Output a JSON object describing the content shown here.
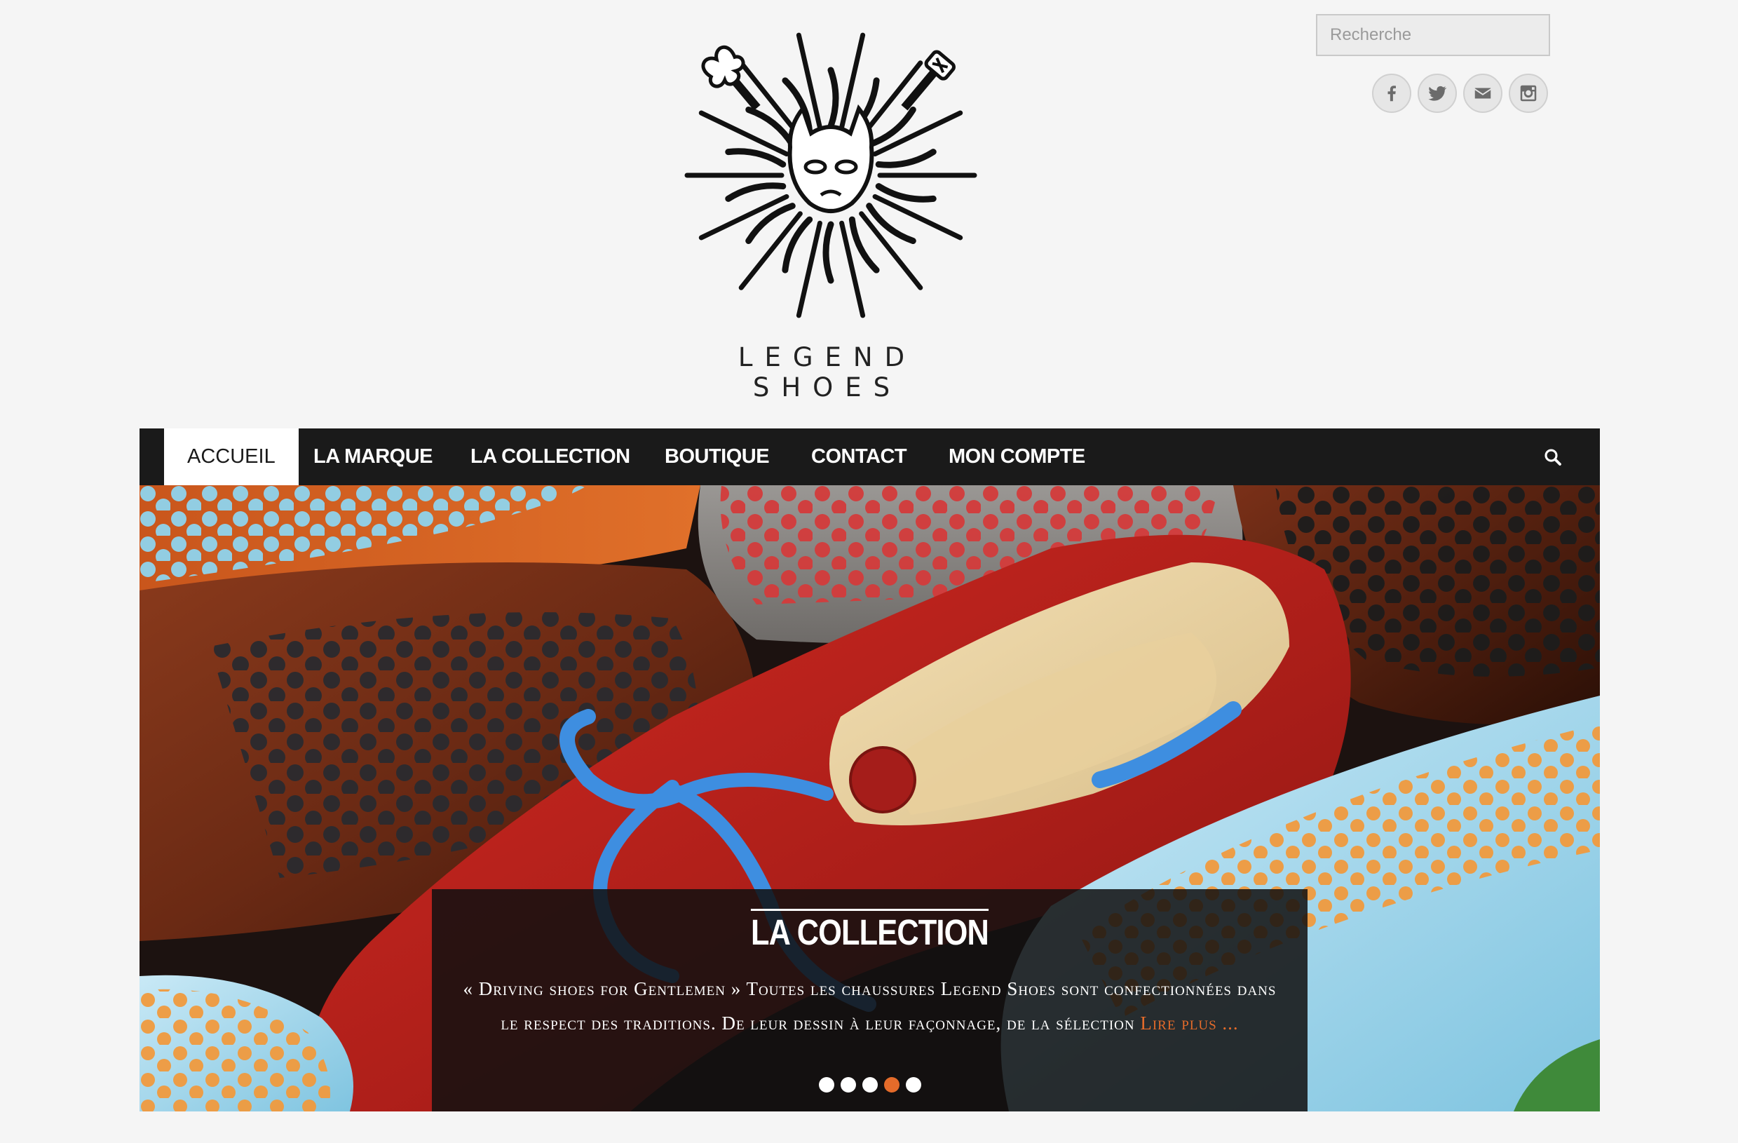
{
  "header": {
    "search": {
      "placeholder": "Recherche"
    },
    "social": [
      {
        "name": "facebook-icon",
        "label": "Facebook"
      },
      {
        "name": "twitter-icon",
        "label": "Twitter"
      },
      {
        "name": "email-icon",
        "label": "Email"
      },
      {
        "name": "instagram-icon",
        "label": "Instagram"
      }
    ],
    "brand_name": "LEGEND SHOES"
  },
  "nav": {
    "items": [
      {
        "label": "ACCUEIL",
        "active": true
      },
      {
        "label": "LA MARQUE",
        "active": false
      },
      {
        "label": "LA COLLECTION",
        "active": false
      },
      {
        "label": "BOUTIQUE",
        "active": false
      },
      {
        "label": "CONTACT",
        "active": false
      },
      {
        "label": "MON COMPTE",
        "active": false
      }
    ],
    "search_icon": "search-icon"
  },
  "hero": {
    "title": "LA COLLECTION",
    "text": "« Driving shoes for Gentlemen » Toutes les chaussures Legend Shoes sont confectionnées dans le respect des traditions. De leur dessin à leur façonnage, de la sélection",
    "read_more": "Lire plus ...",
    "slides_total": 5,
    "active_slide": 4
  },
  "colors": {
    "background": "#f5f5f5",
    "nav_background": "#1a1a1a",
    "accent": "#e46b2a",
    "caption_background": "#121010"
  }
}
